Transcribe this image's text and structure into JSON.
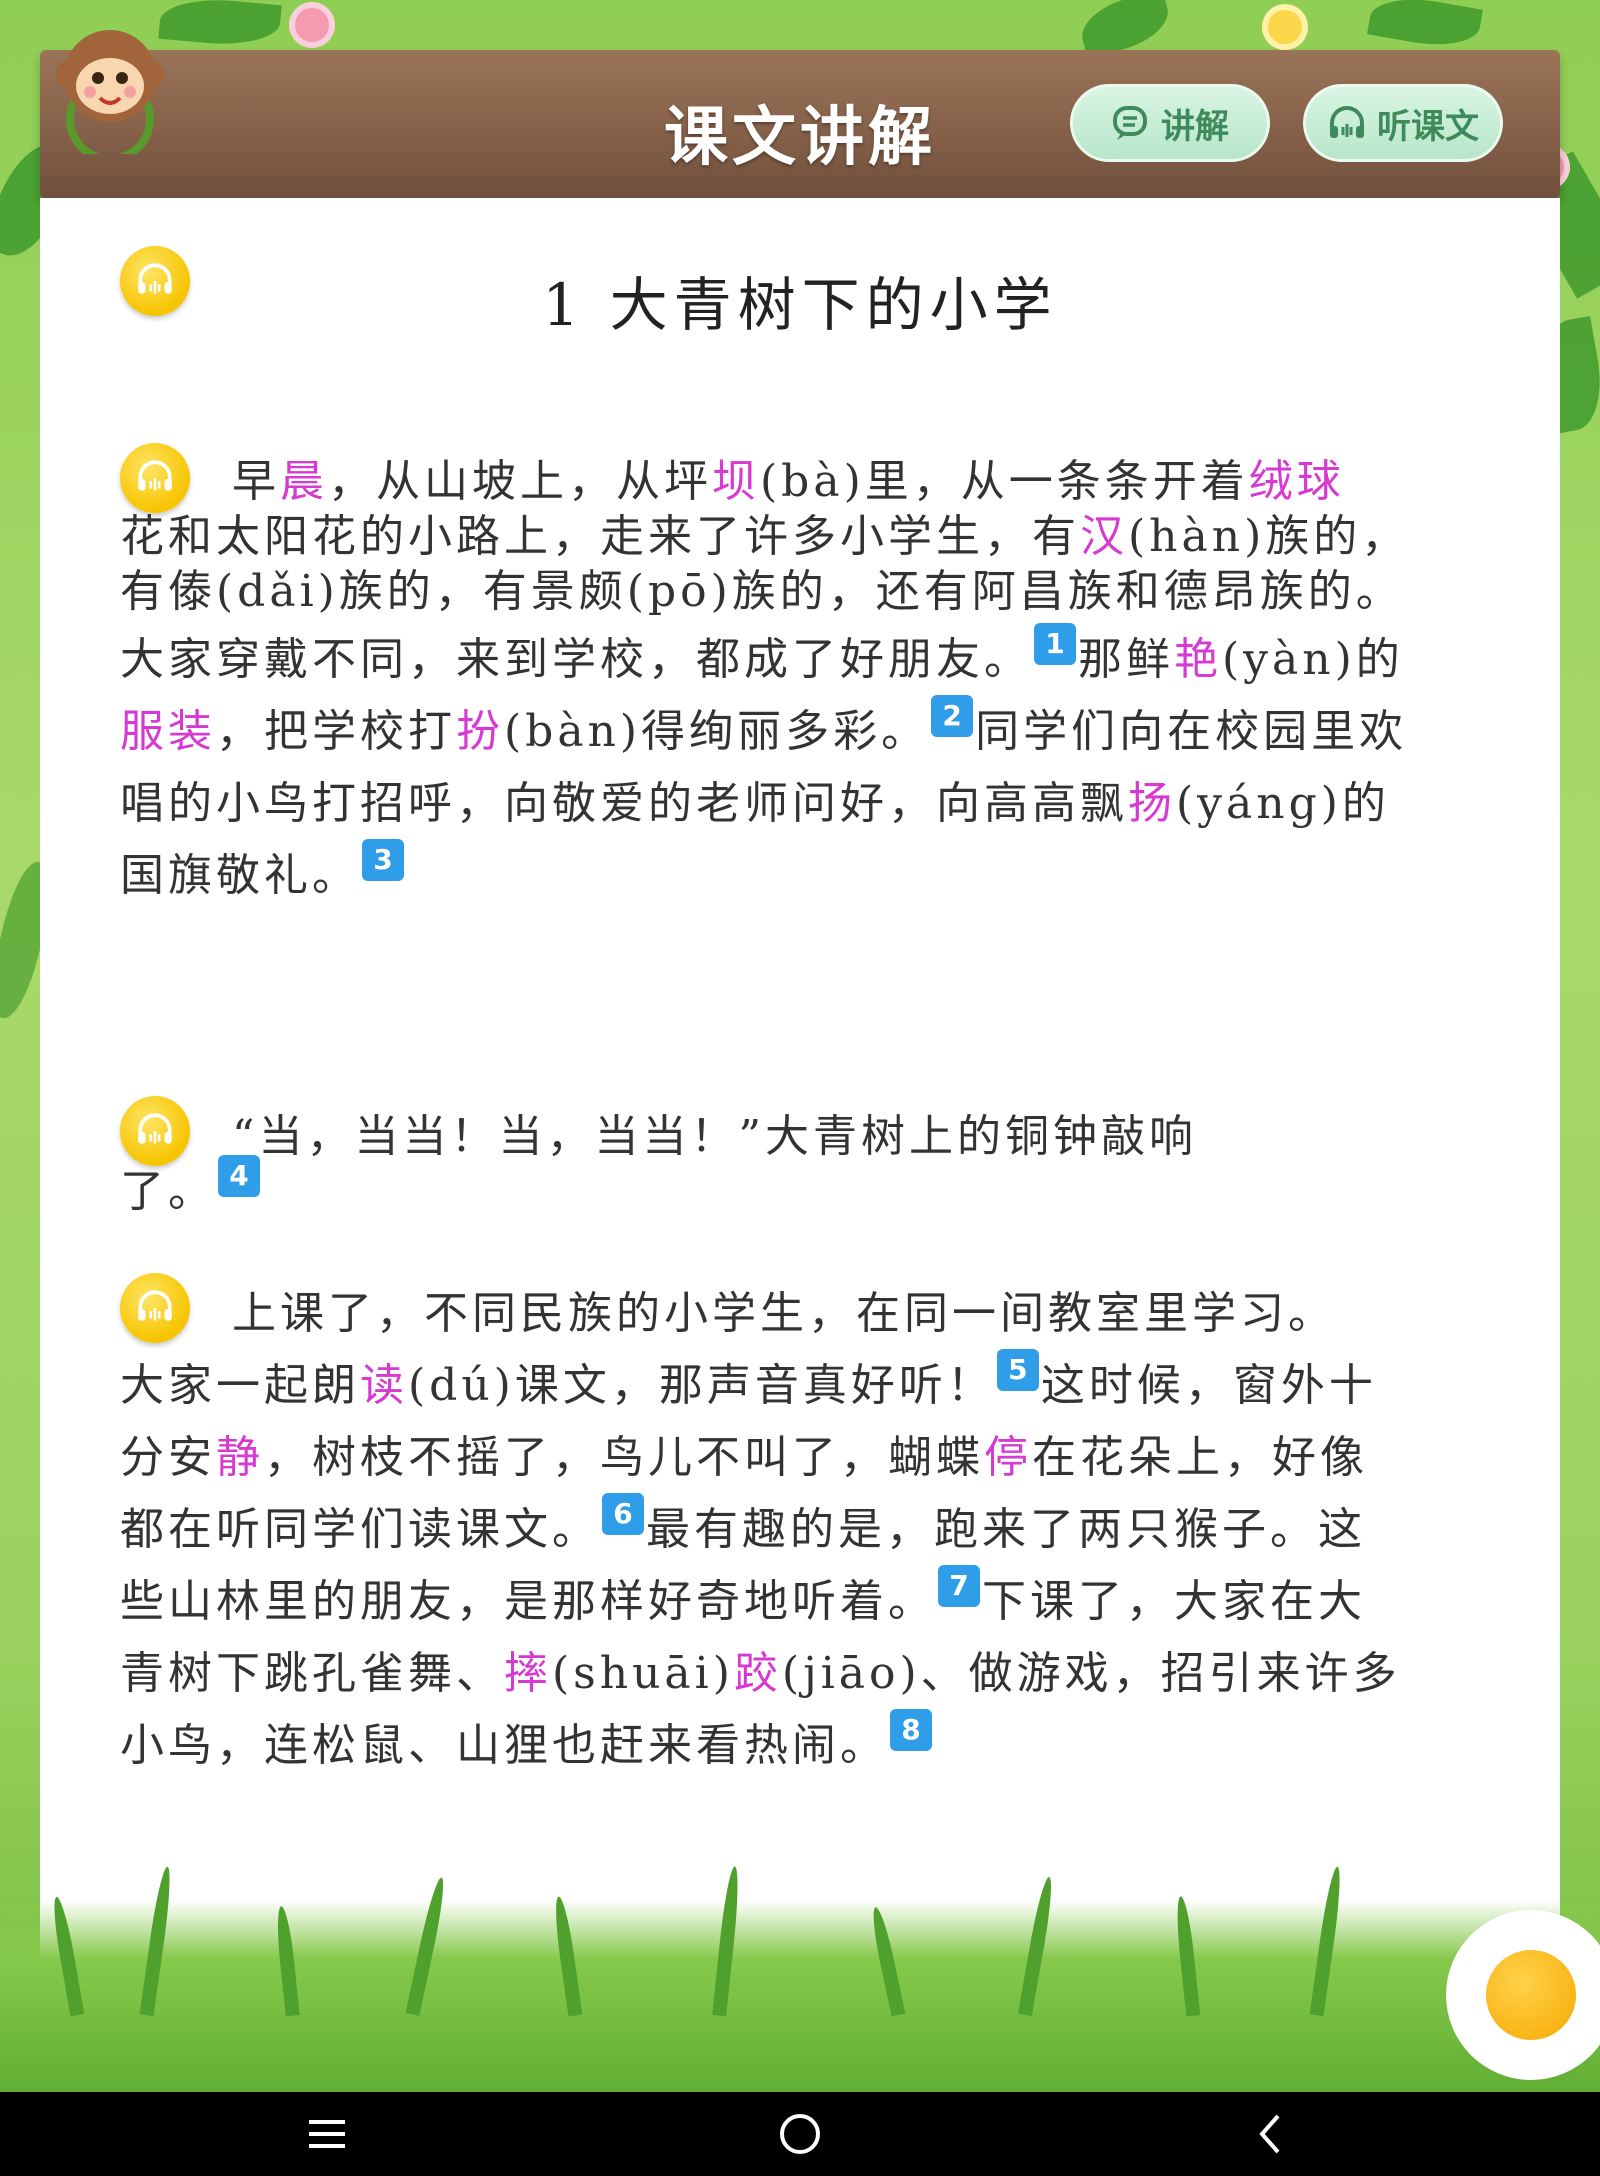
{
  "header": {
    "title": "课文讲解",
    "explain_button": "讲解",
    "listen_button": "听课文"
  },
  "lesson": {
    "title": "1  大青树下的小学"
  },
  "paragraphs": [
    {
      "lines": [
        [
          [
            "早",
            ""
          ],
          [
            "晨",
            "hl"
          ],
          [
            "，从山坡上，从坪",
            ""
          ],
          [
            "坝",
            "hl"
          ],
          [
            "(bà)里，从一条条开着",
            ""
          ],
          [
            "绒球",
            "hl"
          ]
        ],
        [
          [
            "花和太阳花的小路上，走来了许多小学生，有",
            ""
          ],
          [
            "汉",
            "hl"
          ],
          [
            "(hàn)族的，",
            ""
          ]
        ],
        [
          [
            "有傣(dǎi)族的，有景颇(pō)族的，还有阿昌族和德昂族的。",
            ""
          ]
        ],
        [
          [
            "大家穿戴不同，来到学校，都成了好朋友。",
            ""
          ],
          [
            "1",
            "num"
          ],
          [
            "那鲜",
            ""
          ],
          [
            "艳",
            "hl"
          ],
          [
            "(yàn)的",
            ""
          ]
        ],
        [
          [
            "服装",
            "hl"
          ],
          [
            "，把学校打",
            ""
          ],
          [
            "扮",
            "hl"
          ],
          [
            "(bàn)得绚丽多彩。",
            ""
          ],
          [
            "2",
            "num"
          ],
          [
            "同学们向在校园里欢",
            ""
          ]
        ],
        [
          [
            "唱的小鸟打招呼，向敬爱的老师问好，向高高飘",
            ""
          ],
          [
            "扬",
            "hl"
          ],
          [
            "(yáng)的",
            ""
          ]
        ],
        [
          [
            "国旗敬礼。",
            ""
          ],
          [
            "3",
            "num"
          ]
        ]
      ]
    },
    {
      "lines": [
        [
          [
            "“当，当当！当，当当！”大青树上的铜钟敲响",
            ""
          ]
        ],
        [
          [
            "了。",
            ""
          ],
          [
            "4",
            "num"
          ]
        ]
      ]
    },
    {
      "lines": [
        [
          [
            "上课了，不同民族的小学生，在同一间教室里学习。",
            ""
          ]
        ],
        [
          [
            "大家一起朗",
            ""
          ],
          [
            "读",
            "hl"
          ],
          [
            "(dú)课文，那声音真好听！",
            ""
          ],
          [
            "5",
            "num"
          ],
          [
            "这时候，窗外十",
            ""
          ]
        ],
        [
          [
            "分安",
            ""
          ],
          [
            "静",
            "hl"
          ],
          [
            "，树枝不摇了，鸟儿不叫了，蝴蝶",
            ""
          ],
          [
            "停",
            "hl"
          ],
          [
            "在花朵上，好像",
            ""
          ]
        ],
        [
          [
            "都在听同学们读课文。",
            ""
          ],
          [
            "6",
            "num"
          ],
          [
            "最有趣的是，跑来了两只猴子。这",
            ""
          ]
        ],
        [
          [
            "些山林里的朋友，是那样好奇地听着。",
            ""
          ],
          [
            "7",
            "num"
          ],
          [
            "下课了，大家在大",
            ""
          ]
        ],
        [
          [
            "青树下跳孔雀舞、",
            ""
          ],
          [
            "摔",
            "hl"
          ],
          [
            "(shuāi)",
            ""
          ],
          [
            "跤",
            "hl"
          ],
          [
            "(jiāo)、做游戏，招引来许多",
            ""
          ]
        ],
        [
          [
            "小鸟，连松鼠、山狸也赶来看热闹。",
            ""
          ],
          [
            "8",
            "num"
          ]
        ]
      ]
    }
  ],
  "colors": {
    "highlight": "#d63ad1",
    "number_badge": "#2f9de8",
    "audio_button": "#f6c400",
    "header_board": "#86614a"
  },
  "icons": [
    "monkey-logo-icon",
    "speech-bubble-icon",
    "headphones-icon",
    "audio-play-icon",
    "menu-icon",
    "home-icon",
    "back-icon"
  ]
}
